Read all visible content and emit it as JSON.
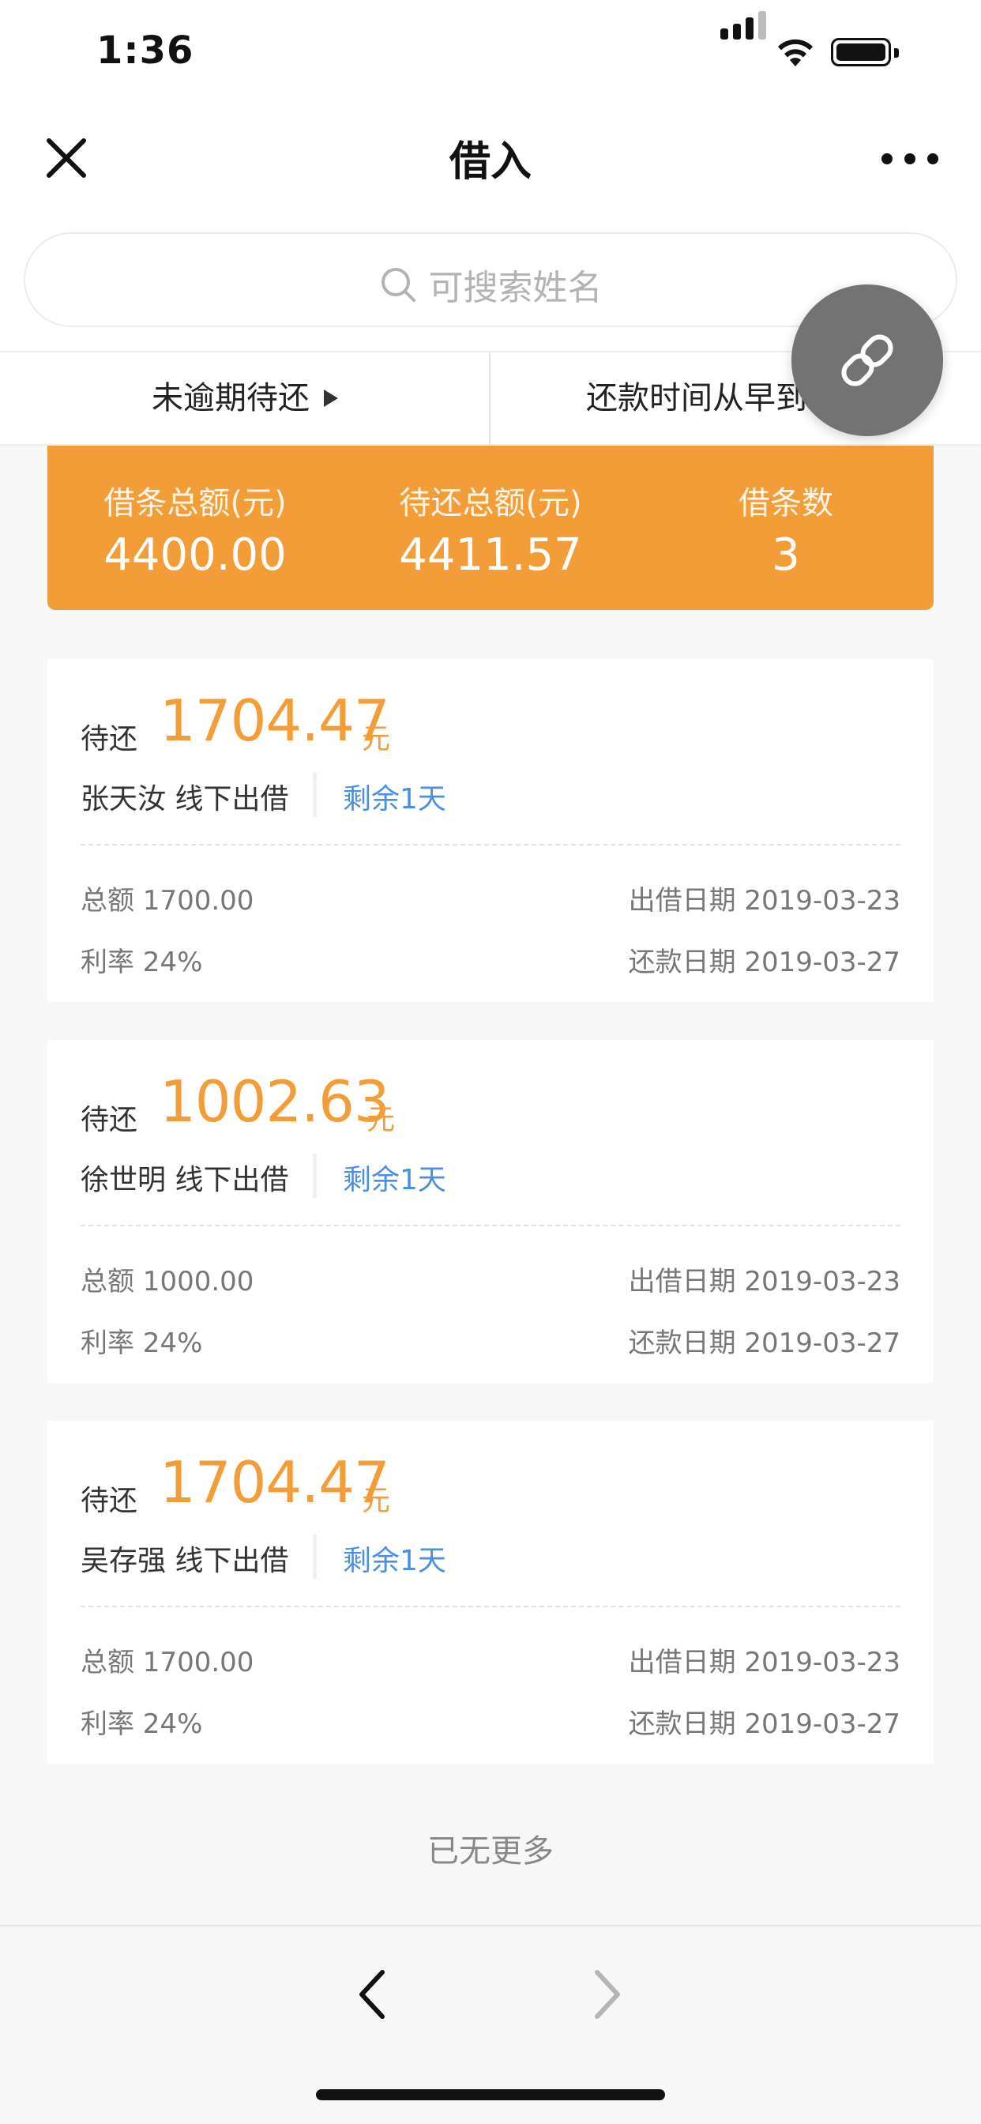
{
  "status_bar": {
    "time": "1:36"
  },
  "nav": {
    "title": "借入"
  },
  "search": {
    "placeholder": "可搜索姓名"
  },
  "filters": {
    "status_label": "未逾期待还",
    "sort_label": "还款时间从早到"
  },
  "summary": {
    "total_loan_label": "借条总额(元)",
    "total_loan_value": "4400.00",
    "total_due_label": "待还总额(元)",
    "total_due_value": "4411.57",
    "count_label": "借条数",
    "count_value": "3"
  },
  "cards": [
    {
      "due_label": "待还",
      "amount": "1704.47",
      "unit": "元",
      "name": "张天汝 线下出借",
      "remain": "剩余1天",
      "total": "总额 1700.00",
      "rate": "利率 24%",
      "lend_date": "出借日期 2019-03-23",
      "repay_date": "还款日期 2019-03-27"
    },
    {
      "due_label": "待还",
      "amount": "1002.63",
      "unit": "元",
      "name": "徐世明 线下出借",
      "remain": "剩余1天",
      "total": "总额 1000.00",
      "rate": "利率 24%",
      "lend_date": "出借日期 2019-03-23",
      "repay_date": "还款日期 2019-03-27"
    },
    {
      "due_label": "待还",
      "amount": "1704.47",
      "unit": "元",
      "name": "吴存强 线下出借",
      "remain": "剩余1天",
      "total": "总额 1700.00",
      "rate": "利率 24%",
      "lend_date": "出借日期 2019-03-23",
      "repay_date": "还款日期 2019-03-27"
    }
  ],
  "footer": {
    "no_more": "已无更多"
  },
  "icons": {
    "close": "close-icon",
    "more": "more-icon",
    "search": "search-icon",
    "link": "link-icon",
    "back": "chevron-left-icon",
    "forward": "chevron-right-icon"
  },
  "colors": {
    "accent": "#f29d38",
    "link_blue": "#4a90e2",
    "fab": "#737373"
  }
}
